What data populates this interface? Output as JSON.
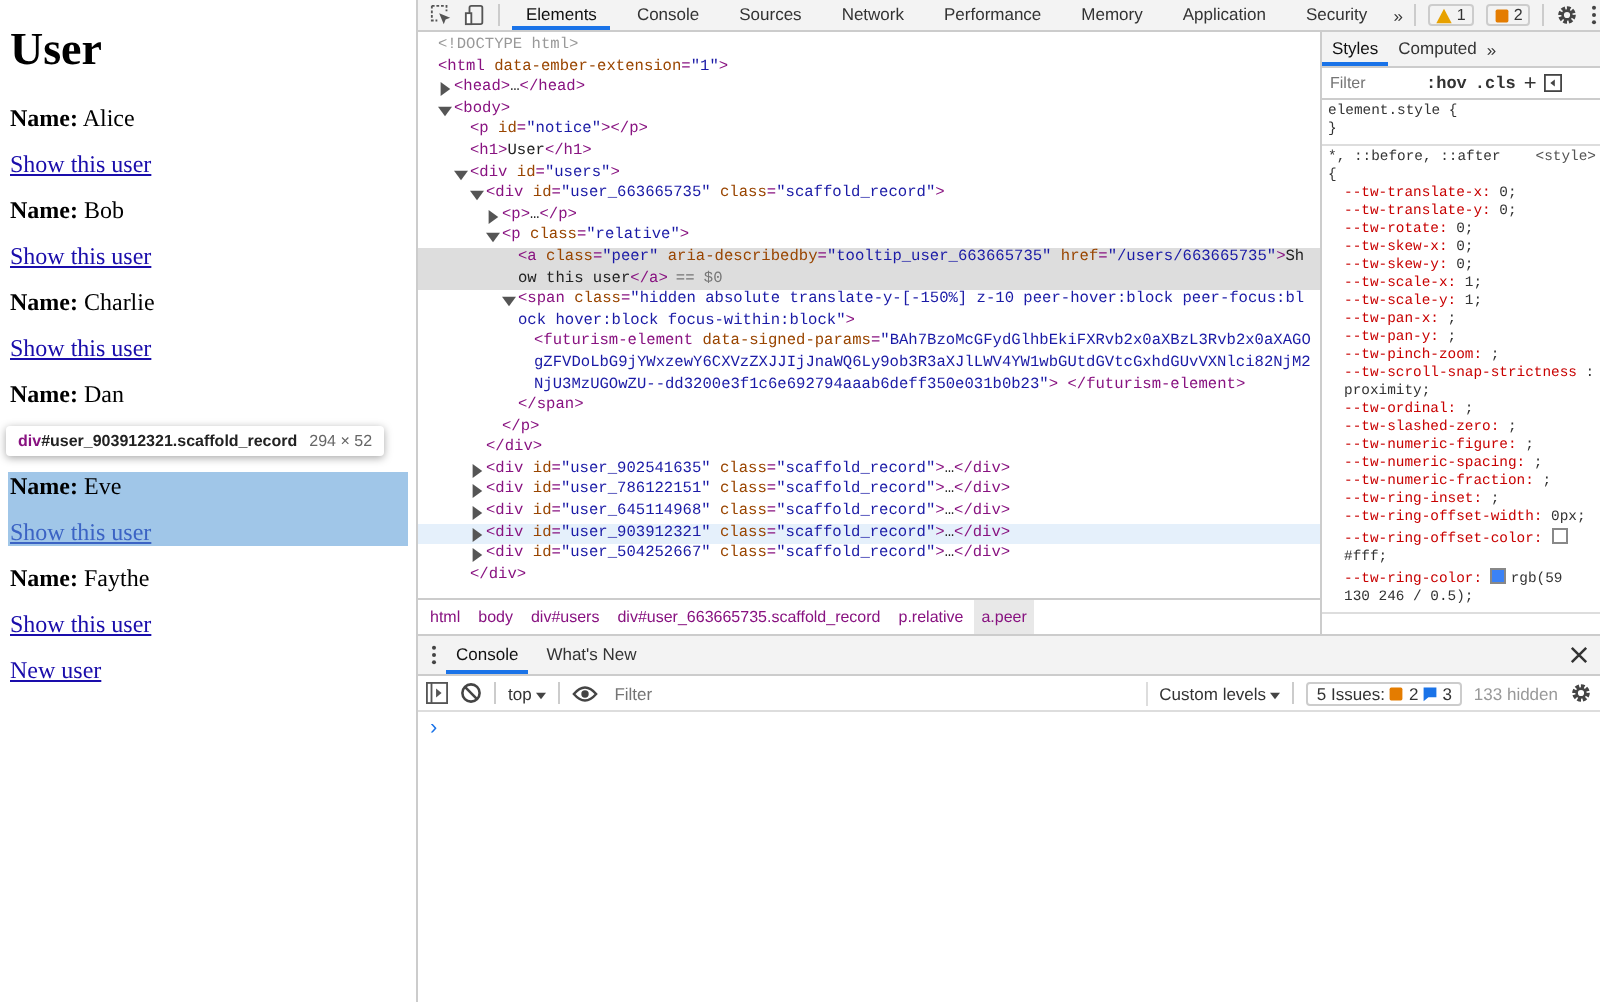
{
  "page": {
    "heading": "User",
    "users": [
      {
        "label": "Name:",
        "name": "Alice",
        "link": "Show this user",
        "highlighted": false
      },
      {
        "label": "Name:",
        "name": "Bob",
        "link": "Show this user",
        "highlighted": false
      },
      {
        "label": "Name:",
        "name": "Charlie",
        "link": "Show this user",
        "highlighted": false
      },
      {
        "label": "Name:",
        "name": "Dan",
        "highlighted": false
      },
      {
        "label": "Name:",
        "name": "Eve",
        "link": "Show this user",
        "highlighted": true
      },
      {
        "label": "Name:",
        "name": "Faythe",
        "link": "Show this user",
        "highlighted": false
      }
    ],
    "new_link": "New user",
    "tooltip": {
      "tag": "div",
      "selector": "#user_903912321.scaffold_record",
      "size": "294 × 52"
    }
  },
  "devtools": {
    "tabs": [
      {
        "label": "Elements",
        "selected": true
      },
      {
        "label": "Console",
        "selected": false
      },
      {
        "label": "Sources",
        "selected": false
      },
      {
        "label": "Network",
        "selected": false
      },
      {
        "label": "Performance",
        "selected": false
      },
      {
        "label": "Memory",
        "selected": false
      },
      {
        "label": "Application",
        "selected": false
      },
      {
        "label": "Security",
        "selected": false
      }
    ],
    "overflow": "»",
    "warnings": "1",
    "issues": "2"
  },
  "elements": {
    "nodes": [
      {
        "text": "<!DOCTYPE html>",
        "kind": "doctype",
        "selected": false,
        "hovered": false
      },
      {
        "text": "<html data-ember-extension=\"1\">",
        "kind": "element",
        "selected": false,
        "hovered": false,
        "children": [
          {
            "text": "<head>…</head>",
            "kind": "element",
            "expanded": false,
            "selected": false,
            "hovered": false
          },
          {
            "text": "<body>",
            "kind": "element",
            "expanded": true,
            "selected": false,
            "hovered": false,
            "children": [
              {
                "text": "<p id=\"notice\"></p>",
                "kind": "element",
                "selected": false,
                "hovered": false
              },
              {
                "text": "<h1>User</h1>",
                "kind": "element",
                "selected": false,
                "hovered": false
              },
              {
                "text": "<div id=\"users\">",
                "kind": "element",
                "expanded": true,
                "close": "</div>",
                "selected": false,
                "hovered": false,
                "children": [
                  {
                    "text": "<div id=\"user_663665735\" class=\"scaffold_record\">",
                    "kind": "element",
                    "expanded": true,
                    "close": "</div>",
                    "selected": false,
                    "hovered": false,
                    "children": [
                      {
                        "text": "<p>…</p>",
                        "kind": "element",
                        "expanded": false,
                        "selected": false,
                        "hovered": false
                      },
                      {
                        "text": "<p class=\"relative\">",
                        "kind": "element",
                        "expanded": true,
                        "close": "</p>",
                        "selected": false,
                        "hovered": false,
                        "children": [
                          {
                            "text": "<a class=\"peer\" aria-describedby=\"tooltip_user_663665735\" href=\"/users/663665735\">Show this user</a>",
                            "kind": "element",
                            "marker": "== $0",
                            "selected": true,
                            "hovered": false
                          },
                          {
                            "text": "<span class=\"hidden absolute translate-y-[-150%] z-10 peer-hover:block peer-focus:block hover:block focus-within:block\">",
                            "kind": "element",
                            "expanded": true,
                            "close": "</span>",
                            "selected": false,
                            "hovered": false,
                            "children": [
                              {
                                "text": "<futurism-element data-signed-params=\"BAh7BzoMcGFydGlhbEkiFXRvb2x0aXBzL3Rvb2x0aXAGOgZFVDoLbG9jYWxzewY6CXVzZXJJIjJnaWQ6Ly9ob3R3aXJlLWV4YW1wbGUtdGVtcGxhdGUvVXNlci82NjM2NjU3MzUGOwZU--dd3200e3f1c6e692794aaab6deff350e031b0b23\"> </futurism-element>",
                                "kind": "element",
                                "selected": false,
                                "hovered": false
                              }
                            ]
                          }
                        ]
                      }
                    ]
                  },
                  {
                    "text": "<div id=\"user_902541635\" class=\"scaffold_record\">…</div>",
                    "kind": "element",
                    "expanded": false,
                    "selected": false,
                    "hovered": false
                  },
                  {
                    "text": "<div id=\"user_786122151\" class=\"scaffold_record\">…</div>",
                    "kind": "element",
                    "expanded": false,
                    "selected": false,
                    "hovered": false
                  },
                  {
                    "text": "<div id=\"user_645114968\" class=\"scaffold_record\">…</div>",
                    "kind": "element",
                    "expanded": false,
                    "selected": false,
                    "hovered": false
                  },
                  {
                    "text": "<div id=\"user_903912321\" class=\"scaffold_record\">…</div>",
                    "kind": "element",
                    "expanded": false,
                    "selected": false,
                    "hovered": true
                  },
                  {
                    "text": "<div id=\"user_504252667\" class=\"scaffold_record\">…</div>",
                    "kind": "element",
                    "expanded": false,
                    "selected": false,
                    "hovered": false
                  }
                ]
              }
            ]
          }
        ]
      }
    ],
    "breadcrumbs": [
      {
        "label": "html",
        "selected": false
      },
      {
        "label": "body",
        "selected": false
      },
      {
        "label": "div#users",
        "selected": false
      },
      {
        "label": "div#user_663665735.scaffold_record",
        "selected": false
      },
      {
        "label": "p.relative",
        "selected": false
      },
      {
        "label": "a.peer",
        "selected": true
      }
    ]
  },
  "styles": {
    "tabs": [
      {
        "label": "Styles",
        "selected": true
      },
      {
        "label": "Computed",
        "selected": false
      }
    ],
    "overflow": "»",
    "filter_placeholder": "Filter",
    "hov": ":hov",
    "cls": ".cls",
    "add": "+",
    "element_style": {
      "selector": "element.style {",
      "close": "}"
    },
    "rule": {
      "selector": "*, ::before, ::after",
      "source": "<style>",
      "open": "{",
      "declarations": [
        {
          "property": "--tw-translate-x:",
          "value": "0;"
        },
        {
          "property": "--tw-translate-y:",
          "value": "0;"
        },
        {
          "property": "--tw-rotate:",
          "value": "0;"
        },
        {
          "property": "--tw-skew-x:",
          "value": "0;"
        },
        {
          "property": "--tw-skew-y:",
          "value": "0;"
        },
        {
          "property": "--tw-scale-x:",
          "value": "1;"
        },
        {
          "property": "--tw-scale-y:",
          "value": "1;"
        },
        {
          "property": "--tw-pan-x:",
          "value": ";"
        },
        {
          "property": "--tw-pan-y:",
          "value": ";"
        },
        {
          "property": "--tw-pinch-zoom:",
          "value": ";"
        },
        {
          "property": "--tw-scroll-snap-strictness",
          "value": ": proximity;"
        },
        {
          "property": "--tw-ordinal:",
          "value": ";"
        },
        {
          "property": "--tw-slashed-zero:",
          "value": ";"
        },
        {
          "property": "--tw-numeric-figure:",
          "value": ";"
        },
        {
          "property": "--tw-numeric-spacing:",
          "value": ";"
        },
        {
          "property": "--tw-numeric-fraction:",
          "value": ";"
        },
        {
          "property": "--tw-ring-inset:",
          "value": ";"
        },
        {
          "property": "--tw-ring-offset-width:",
          "value": "0px;"
        },
        {
          "property": "--tw-ring-offset-color:",
          "value": "#fff;",
          "color": "#ffffff"
        },
        {
          "property": "--tw-ring-color:",
          "value": "rgb(59 130 246 / 0.5);",
          "color": "#3b82f6"
        }
      ]
    }
  },
  "drawer": {
    "tabs": [
      {
        "label": "Console",
        "selected": true
      },
      {
        "label": "What's New",
        "selected": false
      }
    ],
    "context": "top",
    "filter_placeholder": "Filter",
    "levels": "Custom levels",
    "issues_label": "5 Issues:",
    "issue_warnings": "2",
    "issue_infos": "3",
    "hidden": "133 hidden",
    "prompt": "›"
  }
}
